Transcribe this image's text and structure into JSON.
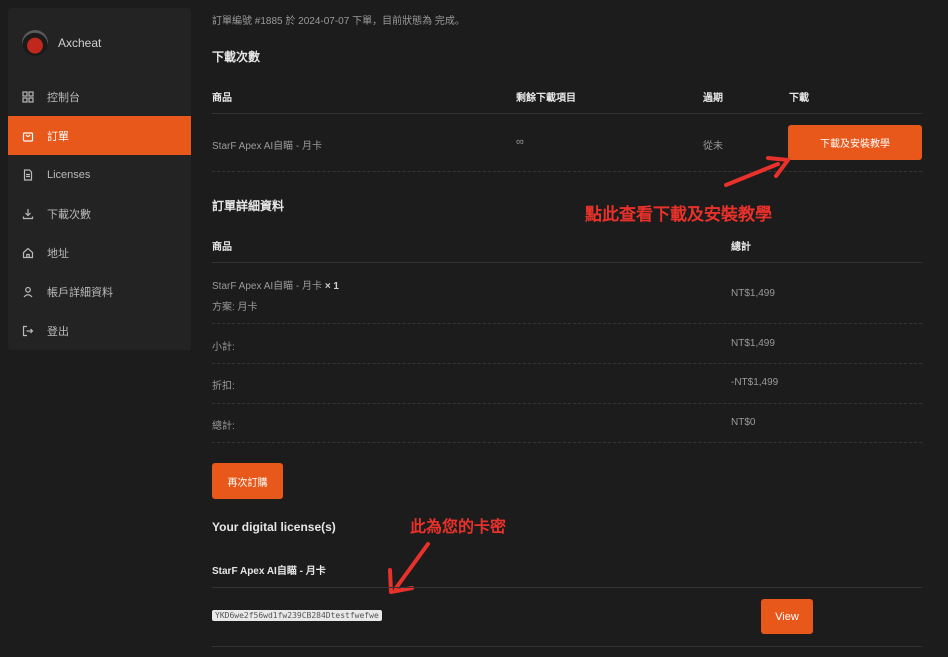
{
  "sidebar": {
    "brand": "Axcheat",
    "items": [
      {
        "label": "控制台"
      },
      {
        "label": "訂單"
      },
      {
        "label": "Licenses"
      },
      {
        "label": "下載次數"
      },
      {
        "label": "地址"
      },
      {
        "label": "帳戶詳細資料"
      },
      {
        "label": "登出"
      }
    ]
  },
  "order_notice": "訂單編號 #1885 於 2024-07-07 下單，目前狀態為 完成。",
  "downloads": {
    "title": "下載次數",
    "headers": {
      "product": "商品",
      "remaining": "剩餘下載項目",
      "expires": "過期",
      "download": "下載"
    },
    "row": {
      "product": "StarF Apex AI自瞄 - 月卡",
      "remaining": "∞",
      "expires": "從未",
      "button": "下載及安裝教學"
    }
  },
  "order_details": {
    "title": "訂單詳細資料",
    "headers": {
      "product": "商品",
      "total": "總計"
    },
    "item": {
      "name": "StarF Apex AI自瞄 - 月卡",
      "qty": "× 1",
      "plan": "方案: 月卡",
      "total": "NT$1,499"
    },
    "subtotal": {
      "label": "小計:",
      "value": "NT$1,499"
    },
    "discount": {
      "label": "折扣:",
      "value": "-NT$1,499"
    },
    "total": {
      "label": "總計:",
      "value": "NT$0"
    }
  },
  "order_again": "再次訂購",
  "licenses": {
    "title": "Your digital license(s)",
    "product": "StarF Apex AI自瞄 - 月卡",
    "code": "YKD6we2f56wd1fw239CB284Dtestfwefwe",
    "view": "View"
  },
  "annotations": {
    "download_hint": "點此查看下載及安裝教學",
    "key_hint": "此為您的卡密"
  },
  "colors": {
    "accent": "#e8581b",
    "annotation": "#e8312a",
    "background": "#1c1c1c",
    "sidebar": "#232323"
  }
}
